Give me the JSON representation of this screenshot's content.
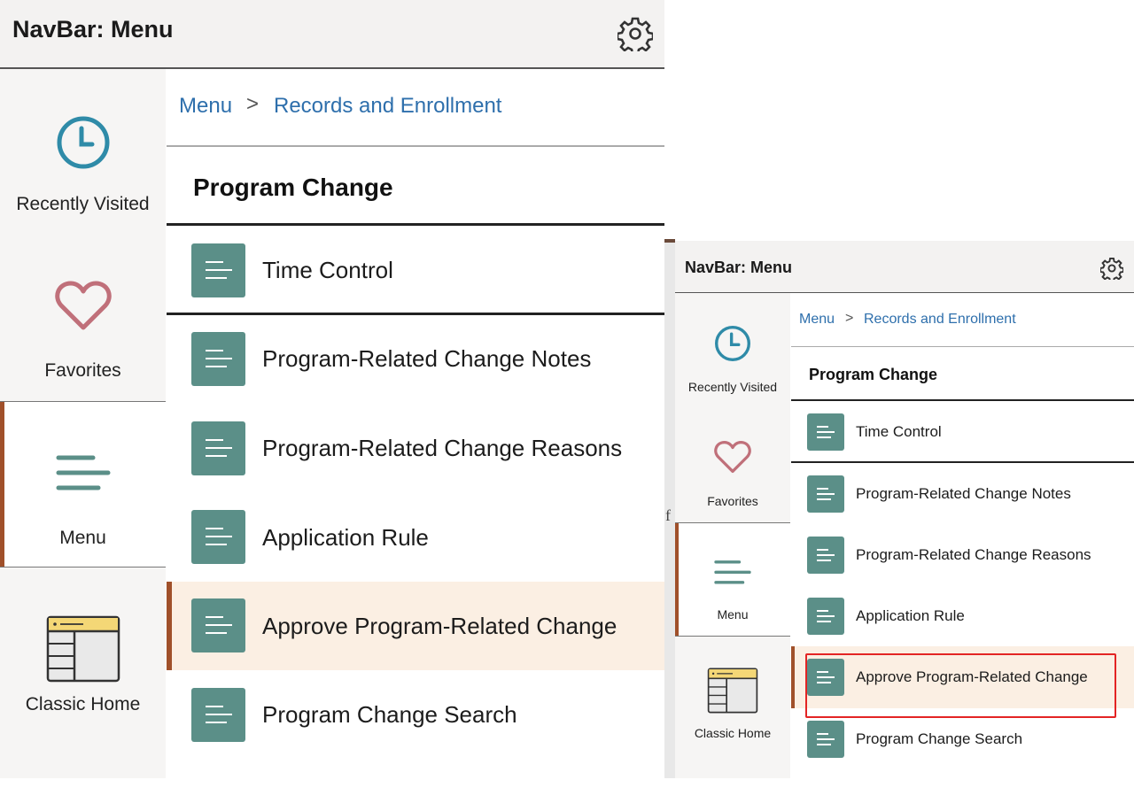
{
  "header": {
    "title": "NavBar: Menu",
    "settings_icon": "gear-icon"
  },
  "sidebar": {
    "items": [
      {
        "label": "Recently Visited",
        "icon": "clock-icon"
      },
      {
        "label": "Favorites",
        "icon": "heart-icon"
      },
      {
        "label": "Menu",
        "icon": "menu-icon",
        "active": true
      },
      {
        "label": "Classic Home",
        "icon": "classic-home-icon"
      }
    ]
  },
  "breadcrumb": {
    "root": "Menu",
    "separator": ">",
    "current": "Records and Enrollment"
  },
  "section_title": "Program Change",
  "menu_items": [
    {
      "label": "Time Control"
    },
    {
      "label": "Program-Related Change Notes"
    },
    {
      "label": "Program-Related Change Reasons"
    },
    {
      "label": "Application Rule"
    },
    {
      "label": "Approve Program-Related Change",
      "selected": true
    },
    {
      "label": "Program Change Search"
    }
  ],
  "partial_left_char": "f",
  "colors": {
    "link": "#2e6fac",
    "accent": "#a0502a",
    "icon_tile": "#5b8f88",
    "selected_bg": "#fbefe3",
    "highlight": "#e32424"
  }
}
